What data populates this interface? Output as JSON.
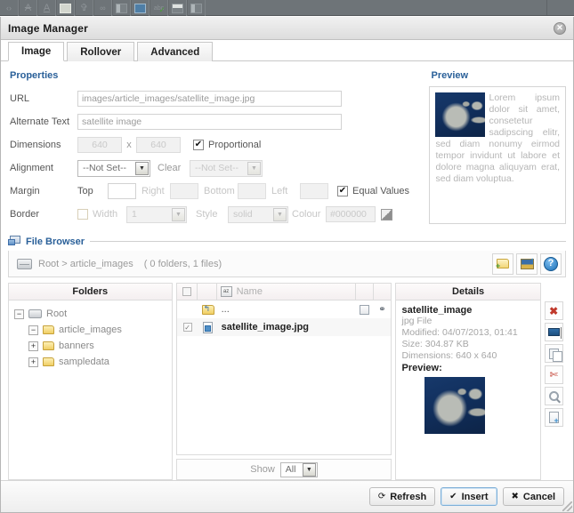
{
  "editor_toolbar": {
    "buttons": [
      {
        "name": "source-code-icon",
        "glyph": "‹›"
      },
      {
        "name": "strikethrough-icon",
        "glyph": "A"
      },
      {
        "name": "underline-icon",
        "glyph": "A"
      },
      {
        "name": "readmore-icon",
        "glyph": ""
      },
      {
        "name": "pagebreak-icon",
        "glyph": ""
      },
      {
        "name": "unlink-icon",
        "glyph": ""
      },
      {
        "name": "horizontal-rule-icon",
        "glyph": ""
      },
      {
        "name": "insert-image-icon",
        "glyph": ""
      },
      {
        "name": "spellcheck-icon",
        "glyph": "abc"
      },
      {
        "name": "table-icon",
        "glyph": ""
      },
      {
        "name": "template-icon",
        "glyph": ""
      }
    ]
  },
  "window": {
    "title": "Image Manager",
    "close_label": "✕"
  },
  "tabs": [
    {
      "label": "Image",
      "active": true
    },
    {
      "label": "Rollover",
      "active": false
    },
    {
      "label": "Advanced",
      "active": false
    }
  ],
  "properties": {
    "section_title": "Properties",
    "url": {
      "label": "URL",
      "value": "images/article_images/satellite_image.jpg",
      "placeholder": ""
    },
    "alternate_text": {
      "label": "Alternate Text",
      "value": "satellite image",
      "placeholder": ""
    },
    "dimensions": {
      "label": "Dimensions",
      "width": "640",
      "height": "640",
      "separator": "x",
      "proportional_label": "Proportional",
      "proportional_checked": "✔"
    },
    "alignment": {
      "label": "Alignment",
      "value": "--Not Set--",
      "clear_label": "Clear",
      "clear_value": "--Not Set--"
    },
    "margin": {
      "label": "Margin",
      "top_label": "Top",
      "right_label": "Right",
      "bottom_label": "Bottom",
      "left_label": "Left",
      "equal_values_label": "Equal Values",
      "equal_values_checked": "✔"
    },
    "border": {
      "label": "Border",
      "width_label": "Width",
      "width_value": "1",
      "style_label": "Style",
      "style_value": "solid",
      "colour_label": "Colour",
      "colour_value": "#000000"
    }
  },
  "preview": {
    "title": "Preview",
    "text": "Lorem ipsum dolor sit amet, consetetur sadipscing elitr, sed diam nonumy eirmod tempor invidunt ut labore et dolore magna aliquyam erat, sed diam voluptua."
  },
  "file_browser": {
    "title": "File Browser",
    "breadcrumb": "Root > article_images",
    "count": "( 0 folders, 1 files)",
    "tools": [
      {
        "name": "new-folder-icon",
        "title": "New Folder"
      },
      {
        "name": "upload-image-icon",
        "title": "Upload"
      },
      {
        "name": "help-icon",
        "title": "Help",
        "glyph": "?"
      }
    ],
    "folders": {
      "header": "Folders",
      "tree": [
        {
          "label": "Root",
          "toggle": "−",
          "depth": 0,
          "type": "drive"
        },
        {
          "label": "article_images",
          "toggle": "−",
          "depth": 1,
          "type": "folder"
        },
        {
          "label": "banners",
          "toggle": "+",
          "depth": 1,
          "type": "folder"
        },
        {
          "label": "sampledata",
          "toggle": "+",
          "depth": 1,
          "type": "folder"
        }
      ]
    },
    "files": {
      "header_name": "Name",
      "rows": [
        {
          "name": "...",
          "checked": "",
          "type": "up"
        },
        {
          "name": "satellite_image.jpg",
          "checked": "✓",
          "type": "file"
        }
      ],
      "show_label": "Show",
      "show_value": "All"
    },
    "details": {
      "header": "Details",
      "name": "satellite_image",
      "file_type": "jpg File",
      "modified": "Modified: 04/07/2013, 01:41",
      "size": "Size: 304.87 KB",
      "dimensions": "Dimensions: 640 x 640",
      "preview_label": "Preview:"
    },
    "actions": [
      {
        "name": "delete-icon",
        "title": "Delete"
      },
      {
        "name": "rename-icon",
        "title": "Rename"
      },
      {
        "name": "copy-icon",
        "title": "Copy"
      },
      {
        "name": "cut-icon",
        "title": "Cut"
      },
      {
        "name": "view-icon",
        "title": "View"
      },
      {
        "name": "paste-icon",
        "title": "Paste"
      }
    ]
  },
  "footer": {
    "refresh": {
      "label": "Refresh",
      "glyph": "⟳"
    },
    "insert": {
      "label": "Insert",
      "glyph": "✔"
    },
    "cancel": {
      "label": "Cancel",
      "glyph": "✖"
    }
  },
  "colors": {
    "accent": "#2a6099",
    "primary_button_border": "#7fb0d8",
    "delete": "#c0392b"
  }
}
